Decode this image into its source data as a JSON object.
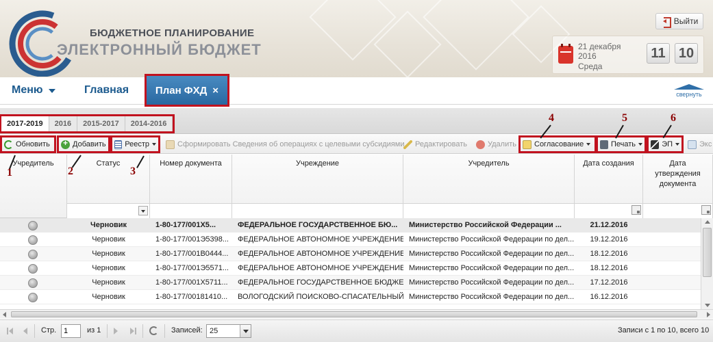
{
  "header": {
    "logo_line1": "БЮДЖЕТНОЕ ПЛАНИРОВАНИЕ",
    "logo_line2": "ЭЛЕКТРОННЫЙ БЮДЖЕТ",
    "logout_label": "Выйти",
    "date_line1": "21 декабря",
    "date_line2": "2016",
    "date_line3": "Среда",
    "time_hours": "11",
    "time_minutes": "10"
  },
  "nav": {
    "menu_label": "Меню",
    "home_label": "Главная",
    "active_tab_label": "План ФХД",
    "active_tab_close": "×",
    "collapse_label": "свернуть"
  },
  "period_tabs": [
    "2017-2019",
    "2016",
    "2015-2017",
    "2014-2016"
  ],
  "toolbar": {
    "refresh": "Обновить",
    "add": "Добавить",
    "registry": "Реестр",
    "form_info": "Сформировать Сведения об операциях с целевыми субсидиями",
    "edit": "Редактировать",
    "delete": "Удалить",
    "approve": "Согласование",
    "print": "Печать",
    "sign": "ЭП",
    "export": "Экс"
  },
  "grid": {
    "columns": [
      "Учредитель",
      "Статус",
      "Номер документа",
      "Учреждение",
      "Учредитель",
      "Дата создания",
      "Дата утверждения документа"
    ],
    "rows": [
      {
        "status": "Черновик",
        "number": "1-80-177/001X5...",
        "institution": "ФЕДЕРАЛЬНОЕ ГОСУДАРСТВЕННОЕ БЮ...",
        "founder": "Министерство Российской Федерации ...",
        "created": "21.12.2016"
      },
      {
        "status": "Черновик",
        "number": "1-80-177/001Э5398...",
        "institution": "ФЕДЕРАЛЬНОЕ АВТОНОМНОЕ УЧРЕЖДЕНИЕ ...",
        "founder": "Министерство Российской Федерации по дел...",
        "created": "19.12.2016"
      },
      {
        "status": "Черновик",
        "number": "1-80-177/001B0444...",
        "institution": "ФЕДЕРАЛЬНОЕ АВТОНОМНОЕ УЧРЕЖДЕНИЕ ...",
        "founder": "Министерство Российской Федерации по дел...",
        "created": "18.12.2016"
      },
      {
        "status": "Черновик",
        "number": "1-80-177/001Э5571...",
        "institution": "ФЕДЕРАЛЬНОЕ АВТОНОМНОЕ УЧРЕЖДЕНИЕ ...",
        "founder": "Министерство Российской Федерации по дел...",
        "created": "18.12.2016"
      },
      {
        "status": "Черновик",
        "number": "1-80-177/001X5711...",
        "institution": "ФЕДЕРАЛЬНОЕ ГОСУДАРСТВЕННОЕ БЮДЖЕ...",
        "founder": "Министерство Российской Федерации по дел...",
        "created": "17.12.2016"
      },
      {
        "status": "Черновик",
        "number": "1-80-177/00181410...",
        "institution": "ВОЛОГОДСКИЙ ПОИСКОВО-СПАСАТЕЛЬНЫЙ...",
        "founder": "Министерство Российской Федерации по дел...",
        "created": "16.12.2016"
      }
    ]
  },
  "paging": {
    "page_label": "Стр.",
    "page_value": "1",
    "of_label": "из 1",
    "records_label": "Записей:",
    "page_size": "25",
    "summary": "Записи с 1 по 10, всего 10"
  },
  "annotations": [
    "1",
    "2",
    "3",
    "4",
    "5",
    "6"
  ],
  "colors": {
    "accent": "#1b5a8e",
    "active_tab": "#2f6fa8",
    "highlight": "#c1121f",
    "annotation_number": "#8b0000"
  }
}
